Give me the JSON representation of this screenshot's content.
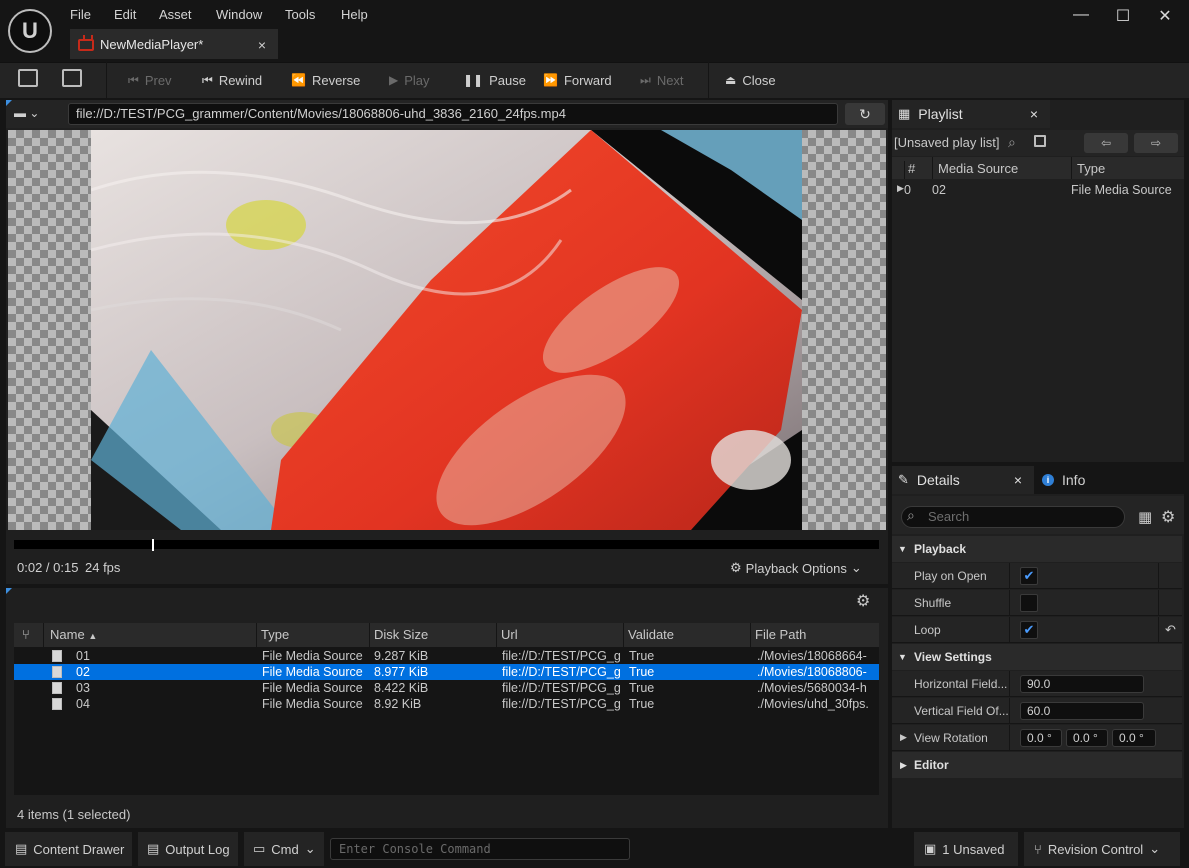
{
  "menu": [
    "File",
    "Edit",
    "Asset",
    "Window",
    "Tools",
    "Help"
  ],
  "document_tab": {
    "label": "NewMediaPlayer*",
    "close": "×"
  },
  "window_controls": {
    "minimize": "—",
    "maximize": "☐",
    "close": "✕"
  },
  "toolbar": {
    "prev": "Prev",
    "rewind": "Rewind",
    "reverse": "Reverse",
    "play": "Play",
    "pause": "Pause",
    "forward": "Forward",
    "next": "Next",
    "close": "Close"
  },
  "viewer": {
    "url": "file://D:/TEST/PCG_grammer/Content/Movies/18068806-uhd_3836_2160_24fps.mp4",
    "time": "0:02 / 0:15",
    "fps": "24 fps",
    "playback_options": "Playback Options",
    "progress": 0.16
  },
  "library": {
    "columns": [
      "Name",
      "Type",
      "Disk Size",
      "Url",
      "Validate",
      "File Path"
    ],
    "rows": [
      {
        "name": "01",
        "type": "File Media Source",
        "size": "9.287 KiB",
        "url": "file://D:/TEST/PCG_g",
        "validate": "True",
        "path": "./Movies/18068664-",
        "selected": false
      },
      {
        "name": "02",
        "type": "File Media Source",
        "size": "8.977 KiB",
        "url": "file://D:/TEST/PCG_g",
        "validate": "True",
        "path": "./Movies/18068806-",
        "selected": true
      },
      {
        "name": "03",
        "type": "File Media Source",
        "size": "8.422 KiB",
        "url": "file://D:/TEST/PCG_g",
        "validate": "True",
        "path": "./Movies/5680034-h",
        "selected": false
      },
      {
        "name": "04",
        "type": "File Media Source",
        "size": "8.92 KiB",
        "url": "file://D:/TEST/PCG_g",
        "validate": "True",
        "path": "./Movies/uhd_30fps.",
        "selected": false
      }
    ],
    "items_count": "4 items (1 selected)"
  },
  "playlist": {
    "tab": "Playlist",
    "close": "×",
    "name": "[Unsaved play list]",
    "columns": [
      "#",
      "Media Source",
      "Type"
    ],
    "rows": [
      {
        "index": "0",
        "source": "02",
        "type": "File Media Source"
      }
    ]
  },
  "details": {
    "tab": "Details",
    "close": "×",
    "info_tab": "Info",
    "search_placeholder": "Search",
    "playback_section": "Playback",
    "play_on_open": "Play on Open",
    "shuffle": "Shuffle",
    "loop": "Loop",
    "view_section": "View Settings",
    "hfov_label": "Horizontal Field...",
    "hfov_value": "90.0",
    "vfov_label": "Vertical Field Of...",
    "vfov_value": "60.0",
    "view_rotation": "View Rotation",
    "rot_x": "0.0 °",
    "rot_y": "0.0 °",
    "rot_z": "0.0 °",
    "editor_section": "Editor"
  },
  "statusbar": {
    "content_drawer": "Content Drawer",
    "output_log": "Output Log",
    "cmd": "Cmd",
    "console_placeholder": "Enter Console Command",
    "unsaved": "1 Unsaved",
    "revision_control": "Revision Control"
  }
}
